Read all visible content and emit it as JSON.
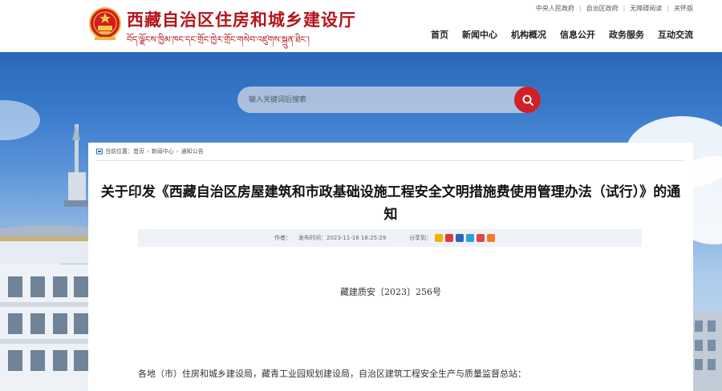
{
  "header": {
    "site_title": "西藏自治区住房和城乡建设厅",
    "site_subtitle": "བོད་ལྗོངས་ཁྱིམ་ཁང་དང་གྲོང་ཁྱེར་གྲོང་གསེབ་འཛུགས་སྐྲུན་ཐིང་།",
    "top_links": [
      "中央人民政府",
      "自治区政府",
      "无障碍阅读",
      "关怀版"
    ],
    "nav": [
      "首页",
      "新闻中心",
      "机构概况",
      "信息公开",
      "政务服务",
      "互动交流"
    ]
  },
  "search": {
    "placeholder": "输入关键词后搜索"
  },
  "breadcrumb": {
    "label": "当前位置：",
    "items": [
      "首页",
      "新闻中心",
      "通知公告"
    ]
  },
  "article": {
    "title": "关于印发《西藏自治区房屋建筑和市政基础设施工程安全文明措施费使用管理办法（试行）》的通知",
    "author_label": "作者：",
    "date": "发布时间：2023-11-16 18:25:29",
    "share_label": "分享到：",
    "doc_number": "藏建质安〔2023〕256号",
    "addressee": "各地（市）住房和城乡建设局，藏青工业园规划建设局，自治区建筑工程安全生产与质量监督总站："
  },
  "colors": {
    "brand_red": "#b3141b",
    "search_button": "#d12027"
  }
}
